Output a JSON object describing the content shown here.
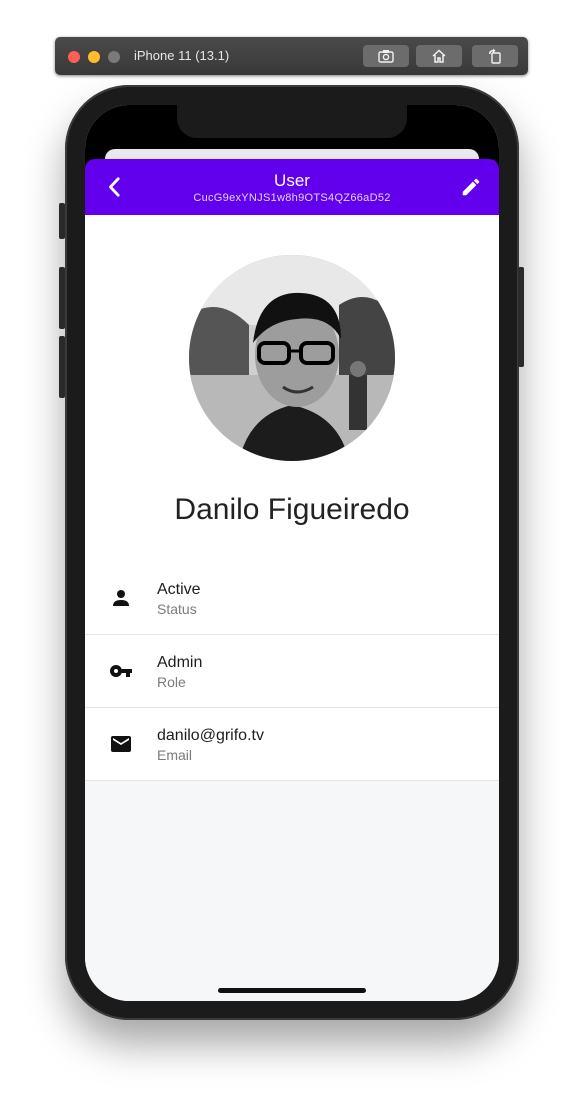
{
  "simulator": {
    "device_title": "iPhone 11 (13.1)",
    "buttons": [
      "screenshot-icon",
      "home-icon",
      "rotate-icon"
    ]
  },
  "header": {
    "title": "User",
    "subtitle": "CucG9exYNJS1w8h9OTS4QZ66aD52",
    "accent": "#6200ee",
    "back_icon": "chevron-left-icon",
    "edit_icon": "pencil-icon"
  },
  "profile": {
    "name": "Danilo Figueiredo",
    "avatar": "avatar-photo"
  },
  "details": [
    {
      "icon": "person-icon",
      "value": "Active",
      "label": "Status"
    },
    {
      "icon": "key-icon",
      "value": "Admin",
      "label": "Role"
    },
    {
      "icon": "mail-icon",
      "value": "danilo@grifo.tv",
      "label": "Email"
    }
  ]
}
